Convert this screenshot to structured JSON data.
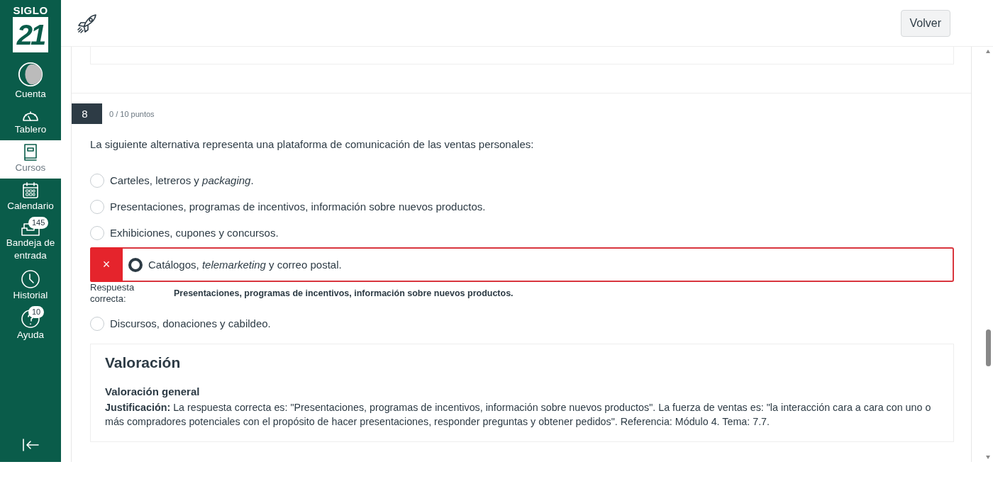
{
  "sidebar": {
    "logo": {
      "top": "SIGLO",
      "number": "21"
    },
    "items": [
      {
        "label": "Cuenta",
        "kind": "avatar",
        "selected": false
      },
      {
        "label": "Tablero",
        "kind": "gauge",
        "selected": false
      },
      {
        "label": "Cursos",
        "kind": "book",
        "selected": true
      },
      {
        "label": "Calendario",
        "kind": "calendar",
        "selected": false
      },
      {
        "label": "Bandeja de entrada",
        "kind": "inbox",
        "selected": false,
        "badge": "145"
      },
      {
        "label": "Historial",
        "kind": "clock",
        "selected": false
      },
      {
        "label": "Ayuda",
        "kind": "help",
        "selected": false,
        "badge": "10"
      }
    ]
  },
  "header": {
    "back_button": "Volver"
  },
  "question": {
    "number": "8",
    "points": "0 / 10 puntos",
    "prompt": "La siguiente alternativa representa una plataforma de comunicación de las ventas personales:",
    "answers": [
      {
        "kind": "option",
        "text": "Carteles, letreros y *packaging*.",
        "selected": false,
        "incorrect": false
      },
      {
        "kind": "option",
        "text": "Presentaciones, programas de incentivos, información sobre nuevos productos.",
        "selected": false,
        "incorrect": false
      },
      {
        "kind": "option",
        "text": "Exhibiciones, cupones y concursos.",
        "selected": false,
        "incorrect": false
      },
      {
        "kind": "option",
        "text": "Catálogos, *telemarketing* y correo postal.",
        "selected": true,
        "incorrect": true,
        "mark": "×"
      },
      {
        "kind": "correct_answer",
        "label": "Respuesta correcta:",
        "text": "Presentaciones, programas de incentivos, información sobre nuevos productos."
      },
      {
        "kind": "option",
        "text": "Discursos, donaciones y cabildeo.",
        "selected": false,
        "incorrect": false
      }
    ],
    "feedback": {
      "title": "Valoración",
      "subtitle": "Valoración general",
      "text": "**Justificación:** La respuesta correcta es: \"Presentaciones, programas de incentivos, información sobre nuevos productos\". La fuerza de ventas es: \"la interacción cara a cara con uno o más compradores potenciales con el propósito de hacer presentaciones, responder preguntas y obtener pedidos\". Referencia: Módulo 4. Tema: 7.7."
    }
  }
}
